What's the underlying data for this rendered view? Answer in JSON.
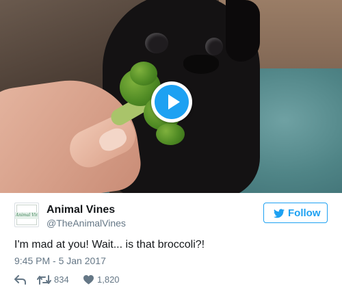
{
  "media": {
    "play_icon": "play-icon",
    "accent_color": "#1da1f2"
  },
  "author": {
    "avatar_text": "Animal Vines",
    "display_name": "Animal Vines",
    "handle": "@TheAnimalVines"
  },
  "follow": {
    "icon": "twitter-bird-icon",
    "label": "Follow"
  },
  "tweet": {
    "text": "I'm mad at you! Wait... is that broccoli?!",
    "timestamp": "9:45 PM - 5 Jan 2017"
  },
  "actions": {
    "reply_icon": "reply-icon",
    "retweet_icon": "retweet-icon",
    "retweet_count": "834",
    "like_icon": "heart-icon",
    "like_count": "1,820"
  }
}
